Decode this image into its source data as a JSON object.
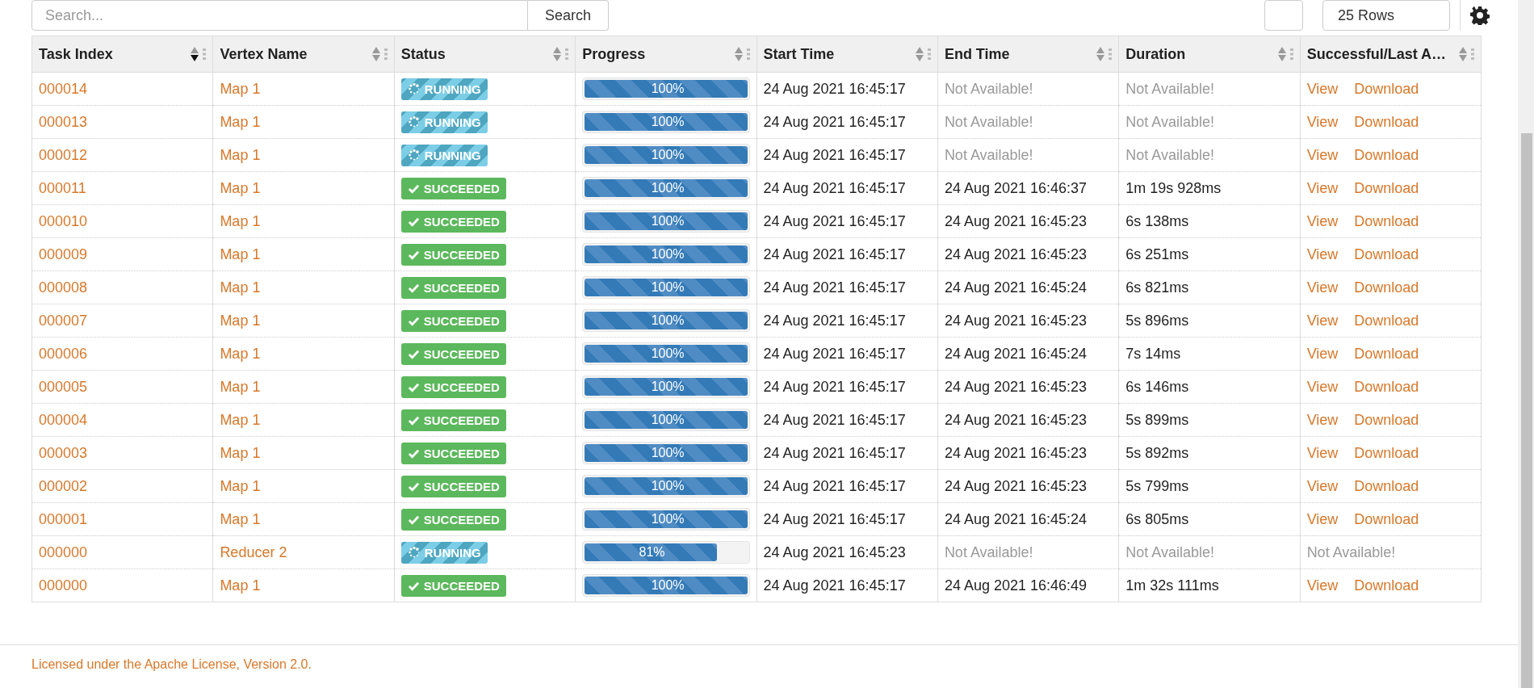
{
  "toolbar": {
    "search": {
      "placeholder": "Search..."
    },
    "search_button": "Search",
    "rows_select": "25 Rows"
  },
  "table": {
    "columns": [
      {
        "label": "Task Index",
        "sorted": true
      },
      {
        "label": "Vertex Name",
        "sorted": false
      },
      {
        "label": "Status",
        "sorted": false
      },
      {
        "label": "Progress",
        "sorted": false
      },
      {
        "label": "Start Time",
        "sorted": false
      },
      {
        "label": "End Time",
        "sorted": false
      },
      {
        "label": "Duration",
        "sorted": false
      },
      {
        "label": "Successful/Last A…",
        "sorted": false
      }
    ],
    "rows": [
      {
        "index": "000014",
        "vertex": "Map 1",
        "status": {
          "kind": "running",
          "label": "RUNNING"
        },
        "progress": {
          "level": 1,
          "label": "100%"
        },
        "start": "24 Aug 2021 16:45:17",
        "end": {
          "text": "Not Available!",
          "muted": true
        },
        "duration": {
          "text": "Not Available!",
          "muted": true
        },
        "logs": {
          "kind": "links",
          "items": [
            "View",
            "Download"
          ]
        }
      },
      {
        "index": "000013",
        "vertex": "Map 1",
        "status": {
          "kind": "running",
          "label": "RUNNING"
        },
        "progress": {
          "level": 1,
          "label": "100%"
        },
        "start": "24 Aug 2021 16:45:17",
        "end": {
          "text": "Not Available!",
          "muted": true
        },
        "duration": {
          "text": "Not Available!",
          "muted": true
        },
        "logs": {
          "kind": "links",
          "items": [
            "View",
            "Download"
          ]
        }
      },
      {
        "index": "000012",
        "vertex": "Map 1",
        "status": {
          "kind": "running",
          "label": "RUNNING"
        },
        "progress": {
          "level": 1,
          "label": "100%"
        },
        "start": "24 Aug 2021 16:45:17",
        "end": {
          "text": "Not Available!",
          "muted": true
        },
        "duration": {
          "text": "Not Available!",
          "muted": true
        },
        "logs": {
          "kind": "links",
          "items": [
            "View",
            "Download"
          ]
        }
      },
      {
        "index": "000011",
        "vertex": "Map 1",
        "status": {
          "kind": "succeeded",
          "label": "SUCCEEDED"
        },
        "progress": {
          "level": 1,
          "label": "100%"
        },
        "start": "24 Aug 2021 16:45:17",
        "end": {
          "text": "24 Aug 2021 16:46:37",
          "muted": false
        },
        "duration": {
          "text": "1m 19s 928ms",
          "muted": false
        },
        "logs": {
          "kind": "links",
          "items": [
            "View",
            "Download"
          ]
        }
      },
      {
        "index": "000010",
        "vertex": "Map 1",
        "status": {
          "kind": "succeeded",
          "label": "SUCCEEDED"
        },
        "progress": {
          "level": 1,
          "label": "100%"
        },
        "start": "24 Aug 2021 16:45:17",
        "end": {
          "text": "24 Aug 2021 16:45:23",
          "muted": false
        },
        "duration": {
          "text": "6s 138ms",
          "muted": false
        },
        "logs": {
          "kind": "links",
          "items": [
            "View",
            "Download"
          ]
        }
      },
      {
        "index": "000009",
        "vertex": "Map 1",
        "status": {
          "kind": "succeeded",
          "label": "SUCCEEDED"
        },
        "progress": {
          "level": 1,
          "label": "100%"
        },
        "start": "24 Aug 2021 16:45:17",
        "end": {
          "text": "24 Aug 2021 16:45:23",
          "muted": false
        },
        "duration": {
          "text": "6s 251ms",
          "muted": false
        },
        "logs": {
          "kind": "links",
          "items": [
            "View",
            "Download"
          ]
        }
      },
      {
        "index": "000008",
        "vertex": "Map 1",
        "status": {
          "kind": "succeeded",
          "label": "SUCCEEDED"
        },
        "progress": {
          "level": 1,
          "label": "100%"
        },
        "start": "24 Aug 2021 16:45:17",
        "end": {
          "text": "24 Aug 2021 16:45:24",
          "muted": false
        },
        "duration": {
          "text": "6s 821ms",
          "muted": false
        },
        "logs": {
          "kind": "links",
          "items": [
            "View",
            "Download"
          ]
        }
      },
      {
        "index": "000007",
        "vertex": "Map 1",
        "status": {
          "kind": "succeeded",
          "label": "SUCCEEDED"
        },
        "progress": {
          "level": 1,
          "label": "100%"
        },
        "start": "24 Aug 2021 16:45:17",
        "end": {
          "text": "24 Aug 2021 16:45:23",
          "muted": false
        },
        "duration": {
          "text": "5s 896ms",
          "muted": false
        },
        "logs": {
          "kind": "links",
          "items": [
            "View",
            "Download"
          ]
        }
      },
      {
        "index": "000006",
        "vertex": "Map 1",
        "status": {
          "kind": "succeeded",
          "label": "SUCCEEDED"
        },
        "progress": {
          "level": 1,
          "label": "100%"
        },
        "start": "24 Aug 2021 16:45:17",
        "end": {
          "text": "24 Aug 2021 16:45:24",
          "muted": false
        },
        "duration": {
          "text": "7s 14ms",
          "muted": false
        },
        "logs": {
          "kind": "links",
          "items": [
            "View",
            "Download"
          ]
        }
      },
      {
        "index": "000005",
        "vertex": "Map 1",
        "status": {
          "kind": "succeeded",
          "label": "SUCCEEDED"
        },
        "progress": {
          "level": 1,
          "label": "100%"
        },
        "start": "24 Aug 2021 16:45:17",
        "end": {
          "text": "24 Aug 2021 16:45:23",
          "muted": false
        },
        "duration": {
          "text": "6s 146ms",
          "muted": false
        },
        "logs": {
          "kind": "links",
          "items": [
            "View",
            "Download"
          ]
        }
      },
      {
        "index": "000004",
        "vertex": "Map 1",
        "status": {
          "kind": "succeeded",
          "label": "SUCCEEDED"
        },
        "progress": {
          "level": 1,
          "label": "100%"
        },
        "start": "24 Aug 2021 16:45:17",
        "end": {
          "text": "24 Aug 2021 16:45:23",
          "muted": false
        },
        "duration": {
          "text": "5s 899ms",
          "muted": false
        },
        "logs": {
          "kind": "links",
          "items": [
            "View",
            "Download"
          ]
        }
      },
      {
        "index": "000003",
        "vertex": "Map 1",
        "status": {
          "kind": "succeeded",
          "label": "SUCCEEDED"
        },
        "progress": {
          "level": 1,
          "label": "100%"
        },
        "start": "24 Aug 2021 16:45:17",
        "end": {
          "text": "24 Aug 2021 16:45:23",
          "muted": false
        },
        "duration": {
          "text": "5s 892ms",
          "muted": false
        },
        "logs": {
          "kind": "links",
          "items": [
            "View",
            "Download"
          ]
        }
      },
      {
        "index": "000002",
        "vertex": "Map 1",
        "status": {
          "kind": "succeeded",
          "label": "SUCCEEDED"
        },
        "progress": {
          "level": 1,
          "label": "100%"
        },
        "start": "24 Aug 2021 16:45:17",
        "end": {
          "text": "24 Aug 2021 16:45:23",
          "muted": false
        },
        "duration": {
          "text": "5s 799ms",
          "muted": false
        },
        "logs": {
          "kind": "links",
          "items": [
            "View",
            "Download"
          ]
        }
      },
      {
        "index": "000001",
        "vertex": "Map 1",
        "status": {
          "kind": "succeeded",
          "label": "SUCCEEDED"
        },
        "progress": {
          "level": 1,
          "label": "100%"
        },
        "start": "24 Aug 2021 16:45:17",
        "end": {
          "text": "24 Aug 2021 16:45:24",
          "muted": false
        },
        "duration": {
          "text": "6s 805ms",
          "muted": false
        },
        "logs": {
          "kind": "links",
          "items": [
            "View",
            "Download"
          ]
        }
      },
      {
        "index": "000000",
        "vertex": "Reducer 2",
        "status": {
          "kind": "running",
          "label": "RUNNING"
        },
        "progress": {
          "level": 0.81,
          "label": "81%"
        },
        "start": "24 Aug 2021 16:45:23",
        "end": {
          "text": "Not Available!",
          "muted": true
        },
        "duration": {
          "text": "Not Available!",
          "muted": true
        },
        "logs": {
          "kind": "text",
          "items": [
            "Not Available!"
          ]
        }
      },
      {
        "index": "000000",
        "vertex": "Map 1",
        "status": {
          "kind": "succeeded",
          "label": "SUCCEEDED"
        },
        "progress": {
          "level": 1,
          "label": "100%"
        },
        "start": "24 Aug 2021 16:45:17",
        "end": {
          "text": "24 Aug 2021 16:46:49",
          "muted": false
        },
        "duration": {
          "text": "1m 32s 111ms",
          "muted": false
        },
        "logs": {
          "kind": "links",
          "items": [
            "View",
            "Download"
          ]
        }
      }
    ]
  },
  "footer": {
    "license": "Licensed under the Apache License, Version 2.0."
  }
}
